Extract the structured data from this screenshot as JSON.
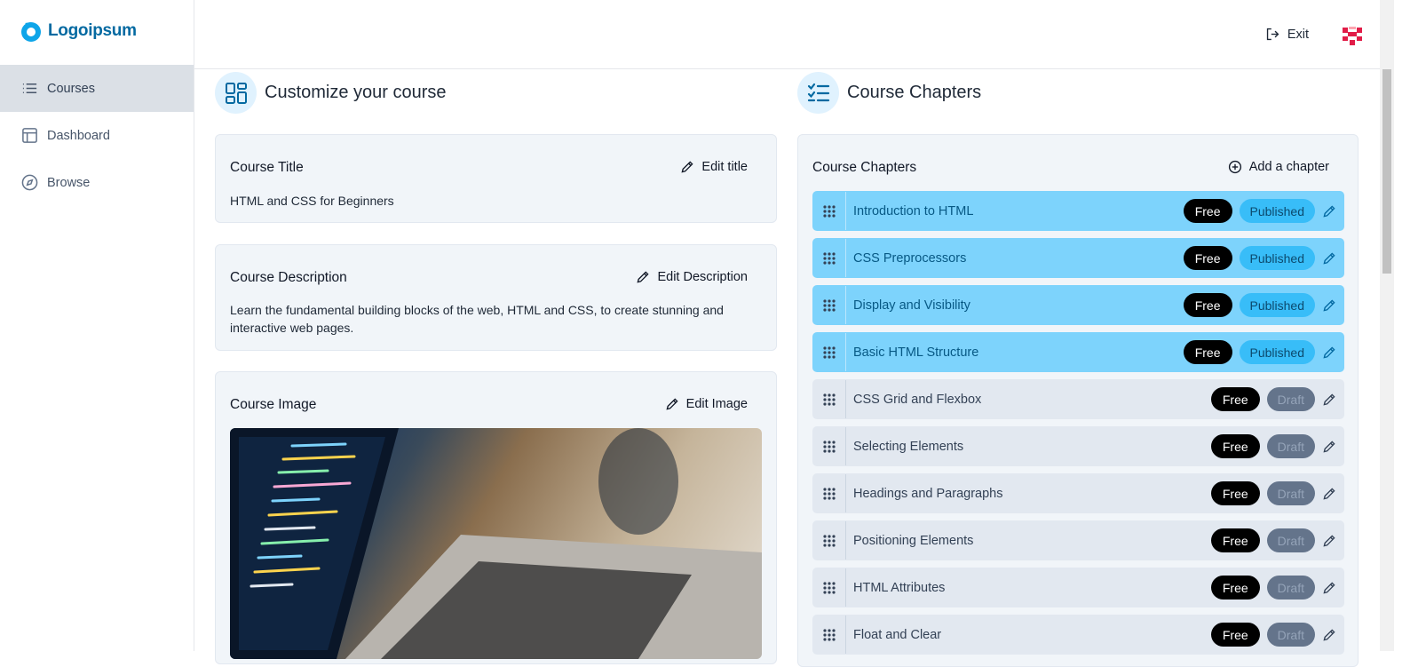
{
  "brand": {
    "logo_text": "Logoipsum"
  },
  "sidebar": {
    "items": [
      {
        "label": "Courses",
        "icon": "list-icon",
        "active": true
      },
      {
        "label": "Dashboard",
        "icon": "layout-icon",
        "active": false
      },
      {
        "label": "Browse",
        "icon": "compass-icon",
        "active": false
      }
    ]
  },
  "topbar": {
    "exit_label": "Exit"
  },
  "customize": {
    "title": "Customize your course",
    "course_title": {
      "label": "Course Title",
      "action": "Edit title",
      "value": "HTML and CSS for Beginners"
    },
    "course_description": {
      "label": "Course Description",
      "action": "Edit Description",
      "value": "Learn the fundamental building blocks of the web, HTML and CSS, to create stunning and interactive web pages."
    },
    "course_image": {
      "label": "Course Image",
      "action": "Edit Image"
    }
  },
  "chapters": {
    "section_title": "Course Chapters",
    "card_title": "Course Chapters",
    "add_label": "Add a chapter",
    "items": [
      {
        "title": "Introduction to HTML",
        "free": "Free",
        "status": "Published"
      },
      {
        "title": "CSS Preprocessors",
        "free": "Free",
        "status": "Published"
      },
      {
        "title": "Display and Visibility",
        "free": "Free",
        "status": "Published"
      },
      {
        "title": "Basic HTML Structure",
        "free": "Free",
        "status": "Published"
      },
      {
        "title": "CSS Grid and Flexbox",
        "free": "Free",
        "status": "Draft"
      },
      {
        "title": "Selecting Elements",
        "free": "Free",
        "status": "Draft"
      },
      {
        "title": "Headings and Paragraphs",
        "free": "Free",
        "status": "Draft"
      },
      {
        "title": "Positioning Elements",
        "free": "Free",
        "status": "Draft"
      },
      {
        "title": "HTML Attributes",
        "free": "Free",
        "status": "Draft"
      },
      {
        "title": "Float and Clear",
        "free": "Free",
        "status": "Draft"
      }
    ]
  },
  "colors": {
    "accent": "#0369a1",
    "published_bg": "#7dd3fc",
    "published_badge": "#38bdf8",
    "draft_badge": "#64748b"
  }
}
